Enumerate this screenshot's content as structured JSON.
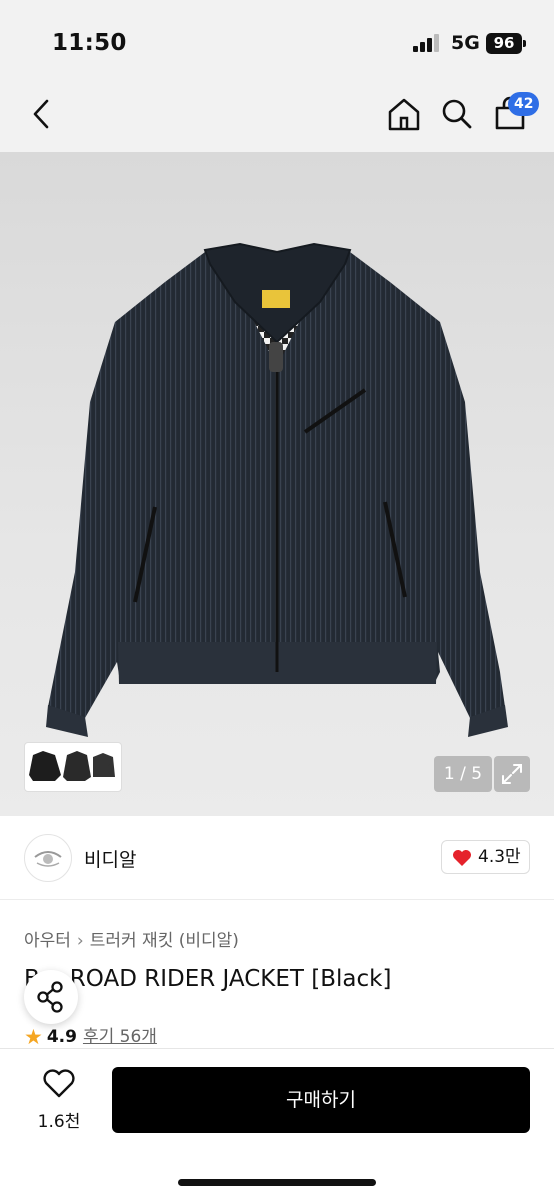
{
  "status": {
    "time": "11:50",
    "network": "5G",
    "battery": "96"
  },
  "nav": {
    "cart_count": "42"
  },
  "gallery": {
    "counter": "1 / 5"
  },
  "brand": {
    "name": "비디알",
    "likes": "4.3만"
  },
  "breadcrumb": {
    "category": "아우터",
    "subcategory": "트러커 재킷 (비디알)"
  },
  "product": {
    "title": "ROAD RIDER JACKET [Black]",
    "title_prefix": "B",
    "rating": "4.9",
    "reviews": "후기 56개"
  },
  "bottom": {
    "wish_count": "1.6천",
    "buy_label": "구매하기"
  },
  "colors": {
    "accent": "#2f6ee6",
    "heart": "#e5222b",
    "star": "#f5a623",
    "buy_bg": "#000000"
  }
}
